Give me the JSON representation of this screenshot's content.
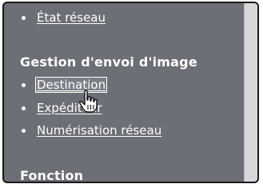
{
  "nav": {
    "top_item": {
      "label": "État réseau"
    },
    "section_image": {
      "title": "Gestion d'envoi d'image",
      "items": [
        {
          "label": "Destination"
        },
        {
          "label": "Expéditeur"
        },
        {
          "label": "Numérisation réseau"
        }
      ]
    },
    "section_function": {
      "title": "Fonction"
    }
  },
  "icons": {
    "cursor": "hand-pointer-icon"
  }
}
